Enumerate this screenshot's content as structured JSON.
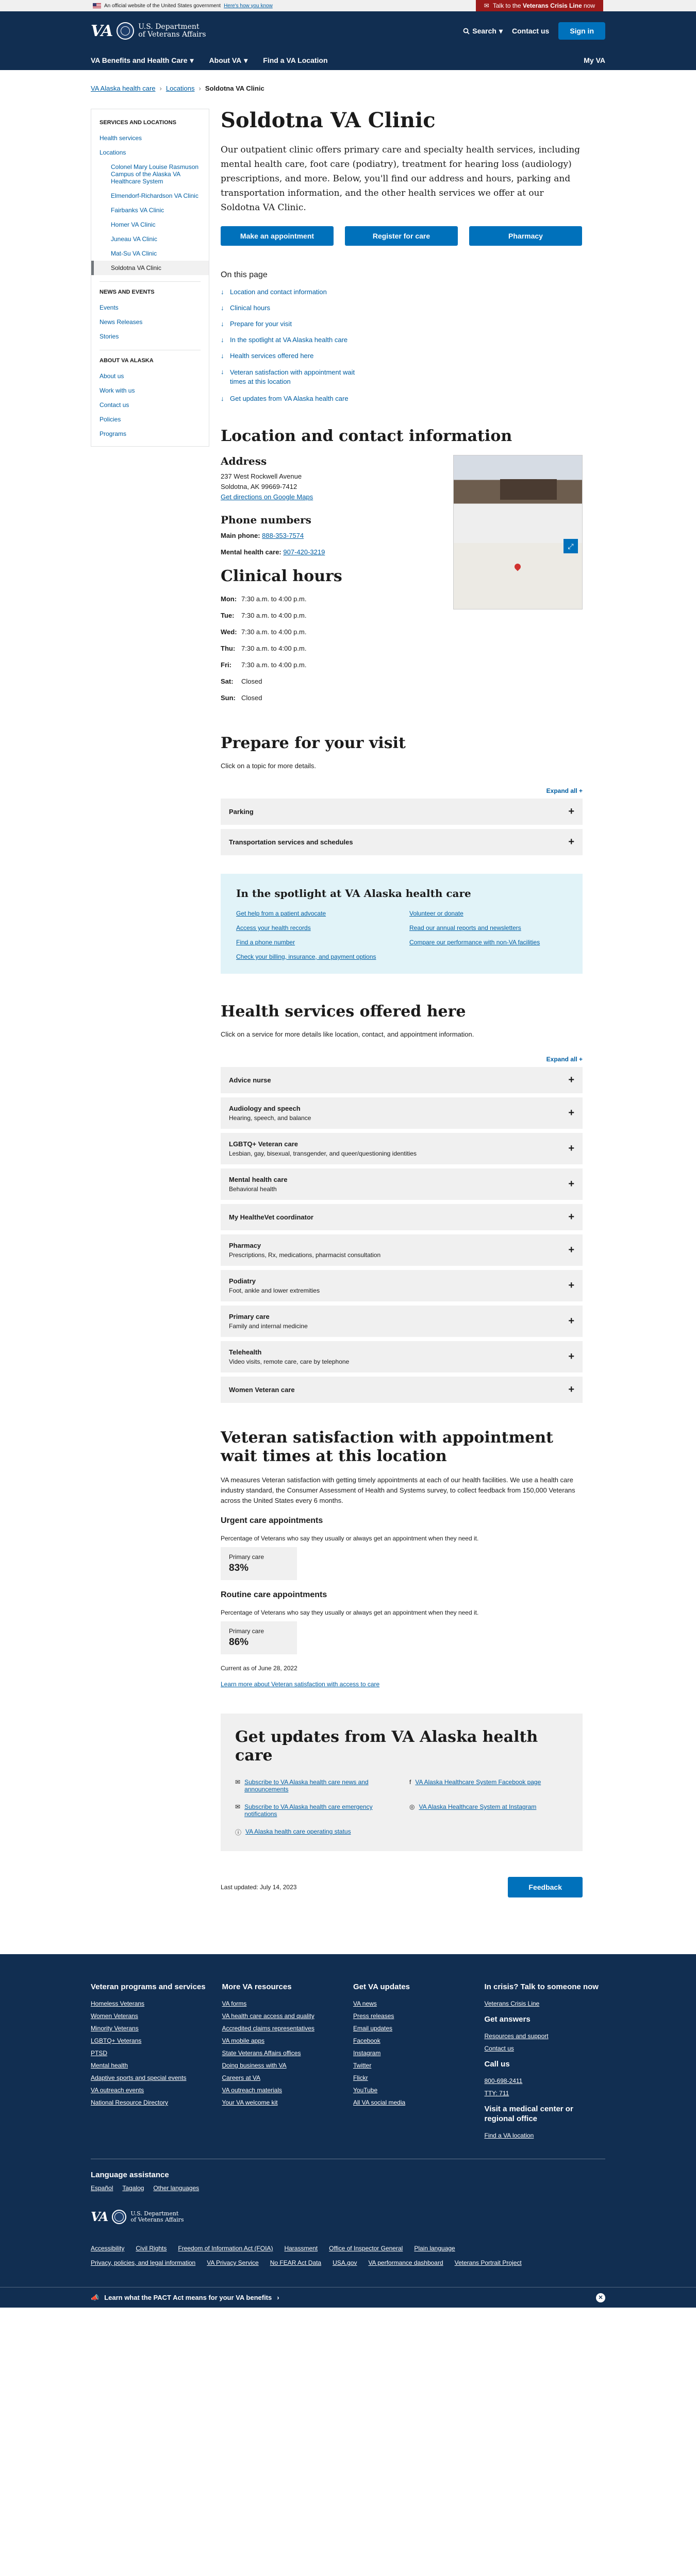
{
  "banner": {
    "official": "An official website of the United States government",
    "how_know": "Here's how you know",
    "crisis_prefix": "Talk to the",
    "crisis_bold": "Veterans Crisis Line",
    "crisis_suffix": "now"
  },
  "header": {
    "logo_va": "VA",
    "dept_line1": "U.S. Department",
    "dept_line2": "of Veterans Affairs",
    "search": "Search",
    "contact": "Contact us",
    "signin": "Sign in",
    "menu1": "VA Benefits and Health Care",
    "menu2": "About VA",
    "menu3": "Find a VA Location",
    "myva": "My VA"
  },
  "breadcrumbs": [
    "VA Alaska health care",
    "Locations",
    "Soldotna VA Clinic"
  ],
  "sidenav": {
    "section1": "SERVICES AND LOCATIONS",
    "health": "Health services",
    "locations": "Locations",
    "sub": [
      "Colonel Mary Louise Rasmuson Campus of the Alaska VA Healthcare System",
      "Elmendorf-Richardson VA Clinic",
      "Fairbanks VA Clinic",
      "Homer VA Clinic",
      "Juneau VA Clinic",
      "Mat-Su VA Clinic",
      "Soldotna VA Clinic"
    ],
    "section2": "NEWS AND EVENTS",
    "events": "Events",
    "news": "News Releases",
    "stories": "Stories",
    "section3": "ABOUT VA ALASKA",
    "about": "About us",
    "work": "Work with us",
    "contact": "Contact us",
    "policies": "Policies",
    "programs": "Programs"
  },
  "main": {
    "title": "Soldotna VA Clinic",
    "intro": "Our outpatient clinic offers primary care and specialty health services, including mental health care, foot care (podiatry), treatment for hearing loss (audiology) prescriptions, and more. Below, you'll find our address and hours, parking and transportation information, and the other health services we offer at our Soldotna VA Clinic.",
    "btn_appt": "Make an appointment",
    "btn_register": "Register for care",
    "btn_pharmacy": "Pharmacy",
    "toc_title": "On this page",
    "toc": [
      "Location and contact information",
      "Clinical hours",
      "Prepare for your visit",
      "In the spotlight at VA Alaska health care",
      "Health services offered here",
      "Veteran satisfaction with appointment wait times at this location",
      "Get updates from VA Alaska health care"
    ],
    "loc_title": "Location and contact information",
    "address_h": "Address",
    "addr1": "237 West Rockwell Avenue",
    "addr2": "Soldotna, AK 99669-7412",
    "directions": "Get directions on Google Maps",
    "phone_h": "Phone numbers",
    "main_phone_l": "Main phone:",
    "main_phone": "888-353-7574",
    "mh_l": "Mental health care:",
    "mh": "907-420-3219",
    "hours_h": "Clinical hours",
    "hours": [
      [
        "Mon:",
        "7:30 a.m. to 4:00 p.m."
      ],
      [
        "Tue:",
        "7:30 a.m. to 4:00 p.m."
      ],
      [
        "Wed:",
        "7:30 a.m. to 4:00 p.m."
      ],
      [
        "Thu:",
        "7:30 a.m. to 4:00 p.m."
      ],
      [
        "Fri:",
        "7:30 a.m. to 4:00 p.m."
      ],
      [
        "Sat:",
        "Closed"
      ],
      [
        "Sun:",
        "Closed"
      ]
    ],
    "prep_h": "Prepare for your visit",
    "prep_p": "Click on a topic for more details.",
    "expand_all": "Expand all +",
    "prep_items": [
      "Parking",
      "Transportation services and schedules"
    ],
    "spot_h": "In the spotlight at VA Alaska health care",
    "spot": [
      "Get help from a patient advocate",
      "Volunteer or donate",
      "Access your health records",
      "Read our annual reports and newsletters",
      "Find a phone number",
      "Compare our performance with non-VA facilities",
      "Check your billing, insurance, and payment options"
    ],
    "hs_h": "Health services offered here",
    "hs_p": "Click on a service for more details like location, contact, and appointment information.",
    "services": [
      {
        "t": "Advice nurse",
        "s": ""
      },
      {
        "t": "Audiology and speech",
        "s": "Hearing, speech, and balance"
      },
      {
        "t": "LGBTQ+ Veteran care",
        "s": "Lesbian, gay, bisexual, transgender, and queer/questioning identities"
      },
      {
        "t": "Mental health care",
        "s": "Behavioral health"
      },
      {
        "t": "My HealtheVet coordinator",
        "s": ""
      },
      {
        "t": "Pharmacy",
        "s": "Prescriptions, Rx, medications, pharmacist consultation"
      },
      {
        "t": "Podiatry",
        "s": "Foot, ankle and lower extremities"
      },
      {
        "t": "Primary care",
        "s": "Family and internal medicine"
      },
      {
        "t": "Telehealth",
        "s": "Video visits, remote care, care by telephone"
      },
      {
        "t": "Women Veteran care",
        "s": ""
      }
    ],
    "sat_h": "Veteran satisfaction with appointment wait times at this location",
    "sat_p": "VA measures Veteran satisfaction with getting timely appointments at each of our health facilities. We use a health care industry standard, the Consumer Assessment of Health and Systems survey, to collect feedback from 150,000 Veterans across the United States every 6 months.",
    "urgent_h": "Urgent care appointments",
    "urgent_p": "Percentage of Veterans who say they usually or always get an appointment when they need it.",
    "urgent_l": "Primary care",
    "urgent_v": "83%",
    "routine_h": "Routine care appointments",
    "routine_p": "Percentage of Veterans who say they usually or always get an appointment when they need it.",
    "routine_l": "Primary care",
    "routine_v": "86%",
    "current": "Current as of June 28, 2022",
    "learn": "Learn more about Veteran satisfaction with access to care",
    "upd_h": "Get updates from VA Alaska health care",
    "upd": [
      "Subscribe to VA Alaska health care news and announcements",
      "VA Alaska Healthcare System Facebook page",
      "Subscribe to VA Alaska health care emergency notifications",
      "VA Alaska Healthcare System at Instagram",
      "VA Alaska health care operating status"
    ],
    "updated": "Last updated: July 14, 2023",
    "feedback": "Feedback"
  },
  "footer": {
    "col1_h": "Veteran programs and services",
    "col1": [
      "Homeless Veterans",
      "Women Veterans",
      "Minority Veterans",
      "LGBTQ+ Veterans",
      "PTSD",
      "Mental health",
      "Adaptive sports and special events",
      "VA outreach events",
      "National Resource Directory"
    ],
    "col2_h": "More VA resources",
    "col2": [
      "VA forms",
      "VA health care access and quality",
      "Accredited claims representatives",
      "VA mobile apps",
      "State Veterans Affairs offices",
      "Doing business with VA",
      "Careers at VA",
      "VA outreach materials",
      "Your VA welcome kit"
    ],
    "col3_h": "Get VA updates",
    "col3": [
      "VA news",
      "Press releases",
      "Email updates",
      "Facebook",
      "Instagram",
      "Twitter",
      "Flickr",
      "YouTube",
      "All VA social media"
    ],
    "col4_h": "In crisis? Talk to someone now",
    "col4a": "Veterans Crisis Line",
    "col4_h2": "Get answers",
    "col4b": [
      "Resources and support",
      "Contact us"
    ],
    "col4_h3": "Call us",
    "col4c": [
      "800-698-2411",
      "TTY: 711"
    ],
    "col4_h4": "Visit a medical center or regional office",
    "col4d": "Find a VA location",
    "lang_h": "Language assistance",
    "langs": [
      "Español",
      "Tagalog",
      "Other languages"
    ],
    "bottom": [
      "Accessibility",
      "Civil Rights",
      "Freedom of Information Act (FOIA)",
      "Harassment",
      "Office of Inspector General",
      "Plain language",
      "Privacy, policies, and legal information",
      "VA Privacy Service",
      "No FEAR Act Data",
      "USA.gov",
      "VA performance dashboard",
      "Veterans Portrait Project"
    ],
    "pact": "Learn what the PACT Act means for your VA benefits"
  }
}
